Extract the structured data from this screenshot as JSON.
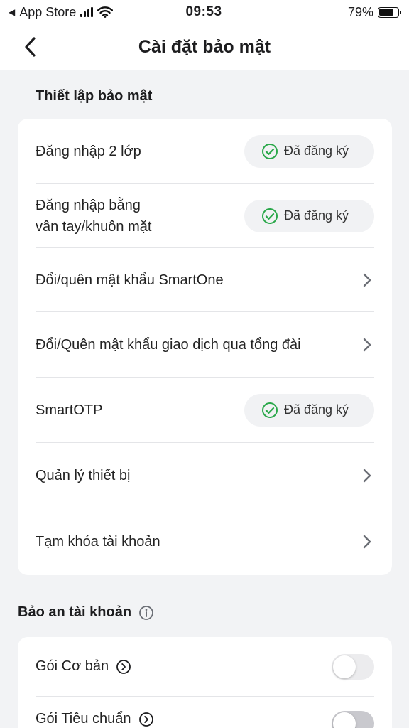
{
  "status_bar": {
    "back_app": "App Store",
    "time": "09:53",
    "battery": "79%",
    "battery_level": 0.79
  },
  "header": {
    "title": "Cài đặt bảo mật"
  },
  "security_setup": {
    "title": "Thiết lập bảo mật",
    "items": [
      {
        "label": "Đăng nhập 2 lớp",
        "badge": "Đã đăng ký"
      },
      {
        "label": "Đăng nhập bằng\nvân tay/khuôn mặt",
        "badge": "Đã đăng ký"
      },
      {
        "label": "Đổi/quên mật khẩu SmartOne"
      },
      {
        "label": "Đổi/Quên mật khẩu giao dịch qua tổng đài"
      },
      {
        "label": "SmartOTP",
        "badge": "Đã đăng ký"
      },
      {
        "label": "Quản lý thiết bị"
      },
      {
        "label": "Tạm khóa tài khoản"
      }
    ]
  },
  "account_protection": {
    "title": "Bảo an tài khoản",
    "packages": [
      {
        "label": "Gói Cơ bản",
        "enabled": false
      },
      {
        "label": "Gói Tiêu chuẩn",
        "enabled": false
      }
    ]
  },
  "colors": {
    "accent_green": "#2aa84a",
    "background": "#f2f3f5",
    "card": "#ffffff",
    "chevron": "#6b6e75"
  }
}
